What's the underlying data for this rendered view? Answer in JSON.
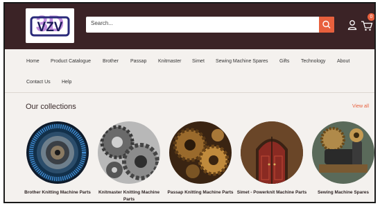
{
  "header": {
    "logo_text": "VZV",
    "logo_superscript": "3D",
    "search_placeholder": "Search...",
    "cart_count": "0",
    "colors": {
      "background": "#3b2326",
      "accent": "#e8603d"
    }
  },
  "nav": {
    "items": [
      "Home",
      "Product Catalogue",
      "Brother",
      "Passap",
      "Knitmaster",
      "Simet",
      "Sewing Machine Spares",
      "Gifts",
      "Technology",
      "About",
      "Contact Us",
      "Help"
    ]
  },
  "collections": {
    "title": "Our collections",
    "view_all": "View all",
    "items": [
      {
        "label": "Brother Knitting Machine Parts",
        "icon": "brother-knitting-image"
      },
      {
        "label": "Knitmaster Knitting Machine Parts",
        "icon": "knitmaster-gears-image"
      },
      {
        "label": "Passap Knitting Machine Parts",
        "icon": "passap-gears-image"
      },
      {
        "label": "Simet - Powerknit Machine Parts",
        "icon": "simet-door-image"
      },
      {
        "label": "Sewing Machine Spares",
        "icon": "sewing-machine-image"
      }
    ]
  }
}
